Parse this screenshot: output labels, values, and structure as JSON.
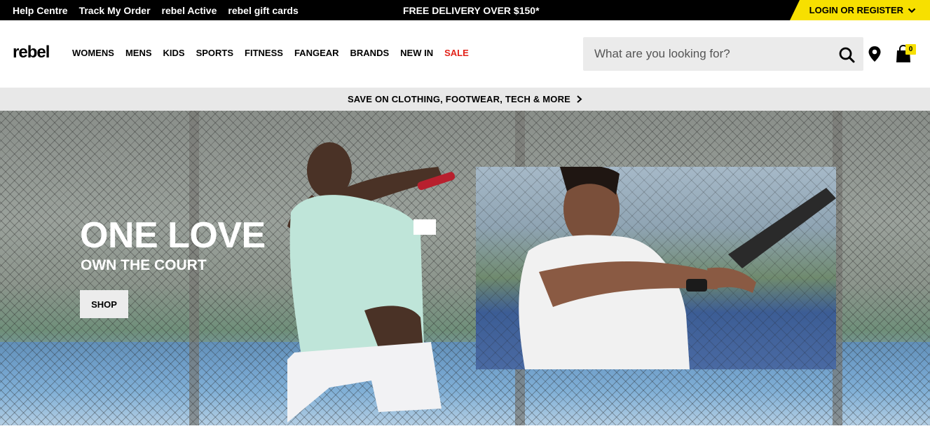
{
  "topbar": {
    "links": [
      "Help Centre",
      "Track My Order",
      "rebel Active",
      "rebel gift cards"
    ],
    "promo": "FREE DELIVERY OVER $150*",
    "login_label": "LOGIN OR REGISTER"
  },
  "header": {
    "logo": "rebel",
    "nav": [
      {
        "label": "WOMENS"
      },
      {
        "label": "MENS"
      },
      {
        "label": "KIDS"
      },
      {
        "label": "SPORTS"
      },
      {
        "label": "FITNESS"
      },
      {
        "label": "FANGEAR"
      },
      {
        "label": "BRANDS"
      },
      {
        "label": "NEW IN"
      },
      {
        "label": "SALE"
      }
    ],
    "search_placeholder": "What are you looking for?",
    "bag_count": "0"
  },
  "strip": {
    "text": "SAVE ON CLOTHING, FOOTWEAR, TECH & MORE"
  },
  "hero": {
    "title": "ONE LOVE",
    "subtitle": "OWN THE COURT",
    "cta": "SHOP"
  },
  "colors": {
    "accent_yellow": "#f7e000",
    "sale_red": "#e2231a"
  }
}
